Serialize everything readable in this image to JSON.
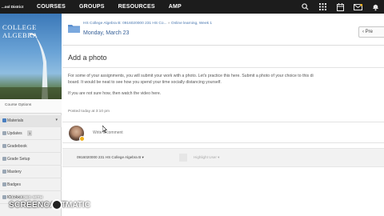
{
  "topnav": {
    "district": "...ool District",
    "links": [
      "COURSES",
      "GROUPS",
      "RESOURCES",
      "AMP"
    ],
    "icons": [
      "search-icon",
      "grid-icon",
      "calendar-icon",
      "mail-icon",
      "notifications-icon"
    ]
  },
  "sidebar": {
    "course_banner": "COLLEGE ALGEBRA",
    "course_options": "Course Options",
    "items": [
      {
        "label": "Materials"
      },
      {
        "label": "Updates",
        "count": "1"
      },
      {
        "label": "Gradebook"
      },
      {
        "label": "Grade Setup"
      },
      {
        "label": "Mastery"
      },
      {
        "label": "Badges"
      },
      {
        "label": "Members"
      }
    ]
  },
  "header": {
    "breadcrumb_1": "HS College Algebra B: 0916020000 231 HS Co...",
    "breadcrumb_sep": "»",
    "breadcrumb_2": "Online learning, Week 1",
    "page_title": "Monday, March 23",
    "prev_label": "Pre"
  },
  "card": {
    "title": "Add a photo",
    "paragraph_1": "For some of your assignments, you will submit your work with a photo.  Let's practice this here.  Submit a photo of your choice to this di",
    "paragraph_2": "board.  It would be neat to see how you spend your time socially distancing yourself.",
    "paragraph_3": "If you are not sure how, then watch the video here.",
    "posted": "Posted today at 3:10 pm",
    "comment_placeholder": "Write a comment",
    "section": "0916020000 231 HS College Algebra B",
    "section_caret": "▾",
    "highlight_user": "Highlight User",
    "highlight_caret": "▾"
  },
  "watermark": {
    "line1": "RECORDED WITH",
    "brand": "SCREENCAST",
    "suffix": "MATIC"
  }
}
